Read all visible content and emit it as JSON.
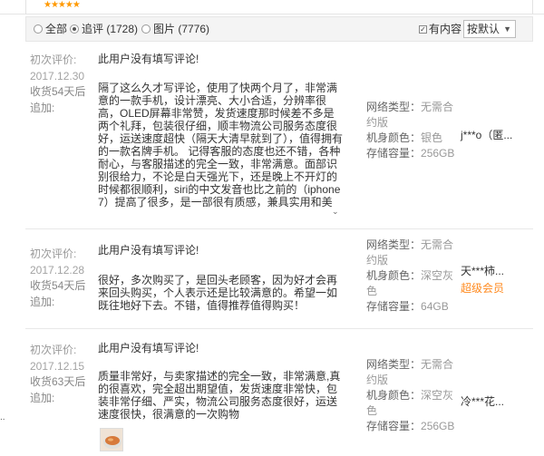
{
  "rating": {
    "stars": "★★★★★"
  },
  "filters": {
    "all_label": "全部",
    "followup_label": "追评 (1728)",
    "photos_label": "图片 (7776)",
    "has_content_label": "有内容",
    "check_mark": "✓",
    "sort_label": "按默认"
  },
  "labels": {
    "first_review": "初次评价:",
    "additional": "追加:",
    "network_key": "网络类型：",
    "color_key": "机身颜色：",
    "storage_key": "存储容量："
  },
  "reviews": [
    {
      "date": "2017.12.30",
      "days_after": "收货54天后",
      "first_text": "此用户没有填写评论!",
      "additional_text": "隔了这么久才写评论，使用了快两个月了，非常满意的一款手机，设计漂亮、大小合适，分辨率很高，OLED屏幕非常赞，发货速度那时候差不多是两个礼拜，包装很仔细，顺丰物流公司服务态度很好，运送速度超快（隔天大清早就到了），值得拥有的一款名牌手机。 记得客服的态度也还不错，各种耐心，与客服描述的完全一致，非常满意。面部识别很给力，不论是白天强光下，还是晚上不开灯的时候都很顺利，siri的中文发音也比之前的（iphone 7）提高了很多，是一部很有质感，兼具实用和美观的手机。",
      "network": "无需合约版",
      "color": "银色",
      "storage": "256GB",
      "user": "j***o（匿...",
      "level": ""
    },
    {
      "date": "2017.12.28",
      "days_after": "收货54天后",
      "first_text": "此用户没有填写评论!",
      "additional_text": "很好，多次购买了，是回头老顾客，因为好才会再来回头购买，个人表示还是比较满意的。希望一如既往地好下去。不错，值得推荐值得购买！",
      "network": "无需合约版",
      "color": "深空灰色",
      "storage": "64GB",
      "user": "天***柿...",
      "level": "超级会员"
    },
    {
      "date": "2017.12.15",
      "days_after": "收货63天后",
      "first_text": "此用户没有填写评论!",
      "additional_text": "质量非常好，与卖家描述的完全一致，非常满意,真的很喜欢，完全超出期望值，发货速度非常快，包装非常仔细、严实，物流公司服务态度很好，运送速度很快，很满意的一次购物",
      "network": "无需合约版",
      "color": "深空灰色",
      "storage": "256GB",
      "user": "冷***花...",
      "level": ""
    }
  ]
}
